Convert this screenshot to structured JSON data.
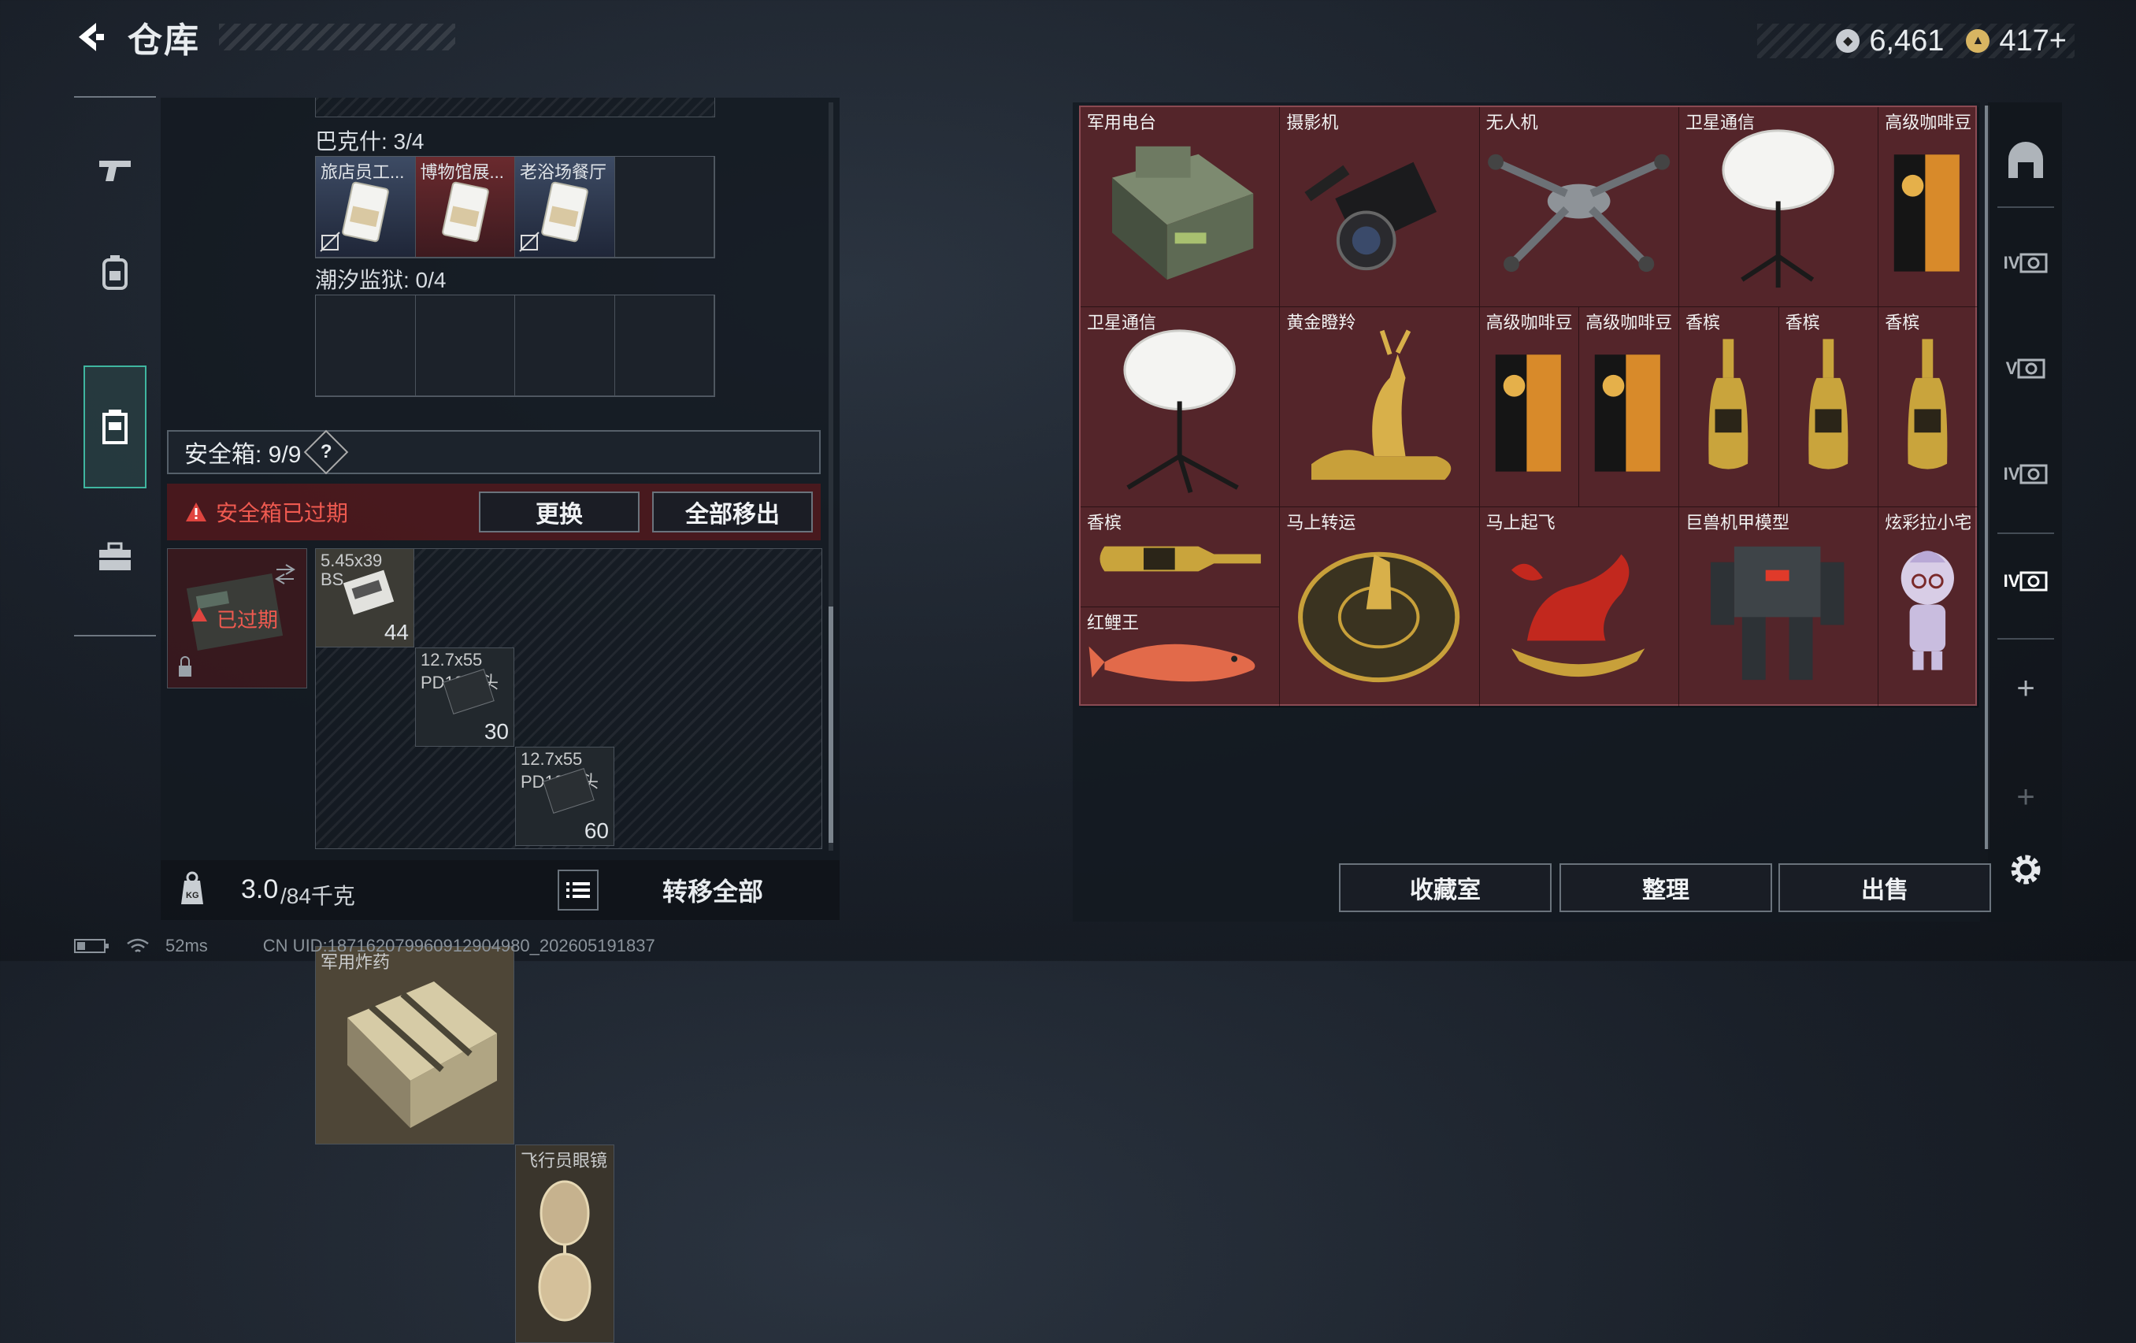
{
  "header": {
    "title": "仓库",
    "currency_silver": "6,461",
    "currency_gold": "417+"
  },
  "left_panel": {
    "map1_label": "巴克什: 3/4",
    "map1_items": [
      "旅店员工...",
      "博物馆展...",
      "老浴场餐厅"
    ],
    "map2_label": "潮汐监狱: 0/4",
    "safe_label": "安全箱: 9/9",
    "safe_help": "?",
    "expired_warning": "安全箱已过期",
    "replace_button": "更换",
    "move_all_out_button": "全部移出",
    "safe_box_status": "已过期",
    "ammo": [
      {
        "name": "5.45x39",
        "sub": "BS",
        "count": "44"
      },
      {
        "name": "12.7x55",
        "sub": "PD12双头",
        "count": "30"
      },
      {
        "name": "12.7x55",
        "sub": "PD12双头",
        "count": "60"
      }
    ],
    "explosive_name": "军用炸药",
    "glasses_name": "飞行员眼镜",
    "weight_current": "3.0",
    "weight_max": "/84千克",
    "transfer_all_button": "转移全部"
  },
  "right_grid": {
    "items": [
      "军用电台",
      "摄影机",
      "无人机",
      "卫星通信",
      "高级咖啡豆",
      "卫星通信",
      "黄金瞪羚",
      "高级咖啡豆",
      "高级咖啡豆",
      "香槟",
      "香槟",
      "香槟",
      "香槟",
      "红鲤王",
      "马上转运",
      "马上起飞",
      "巨兽机甲模型",
      "炫彩拉小宅"
    ]
  },
  "right_side": {
    "add_1": "+",
    "add_2": "+",
    "tiers": [
      "IV",
      "V",
      "IV",
      "IV"
    ]
  },
  "bottom_buttons": {
    "collection": "收藏室",
    "sort": "整理",
    "sell": "出售"
  },
  "status": {
    "latency": "52ms",
    "uid": "CN UID:18716207996091290498​0_202605191837"
  },
  "colors": {
    "accent_teal": "#3fb6a0",
    "item_bg_red": "#54252a",
    "warning_red": "#e0453f"
  }
}
